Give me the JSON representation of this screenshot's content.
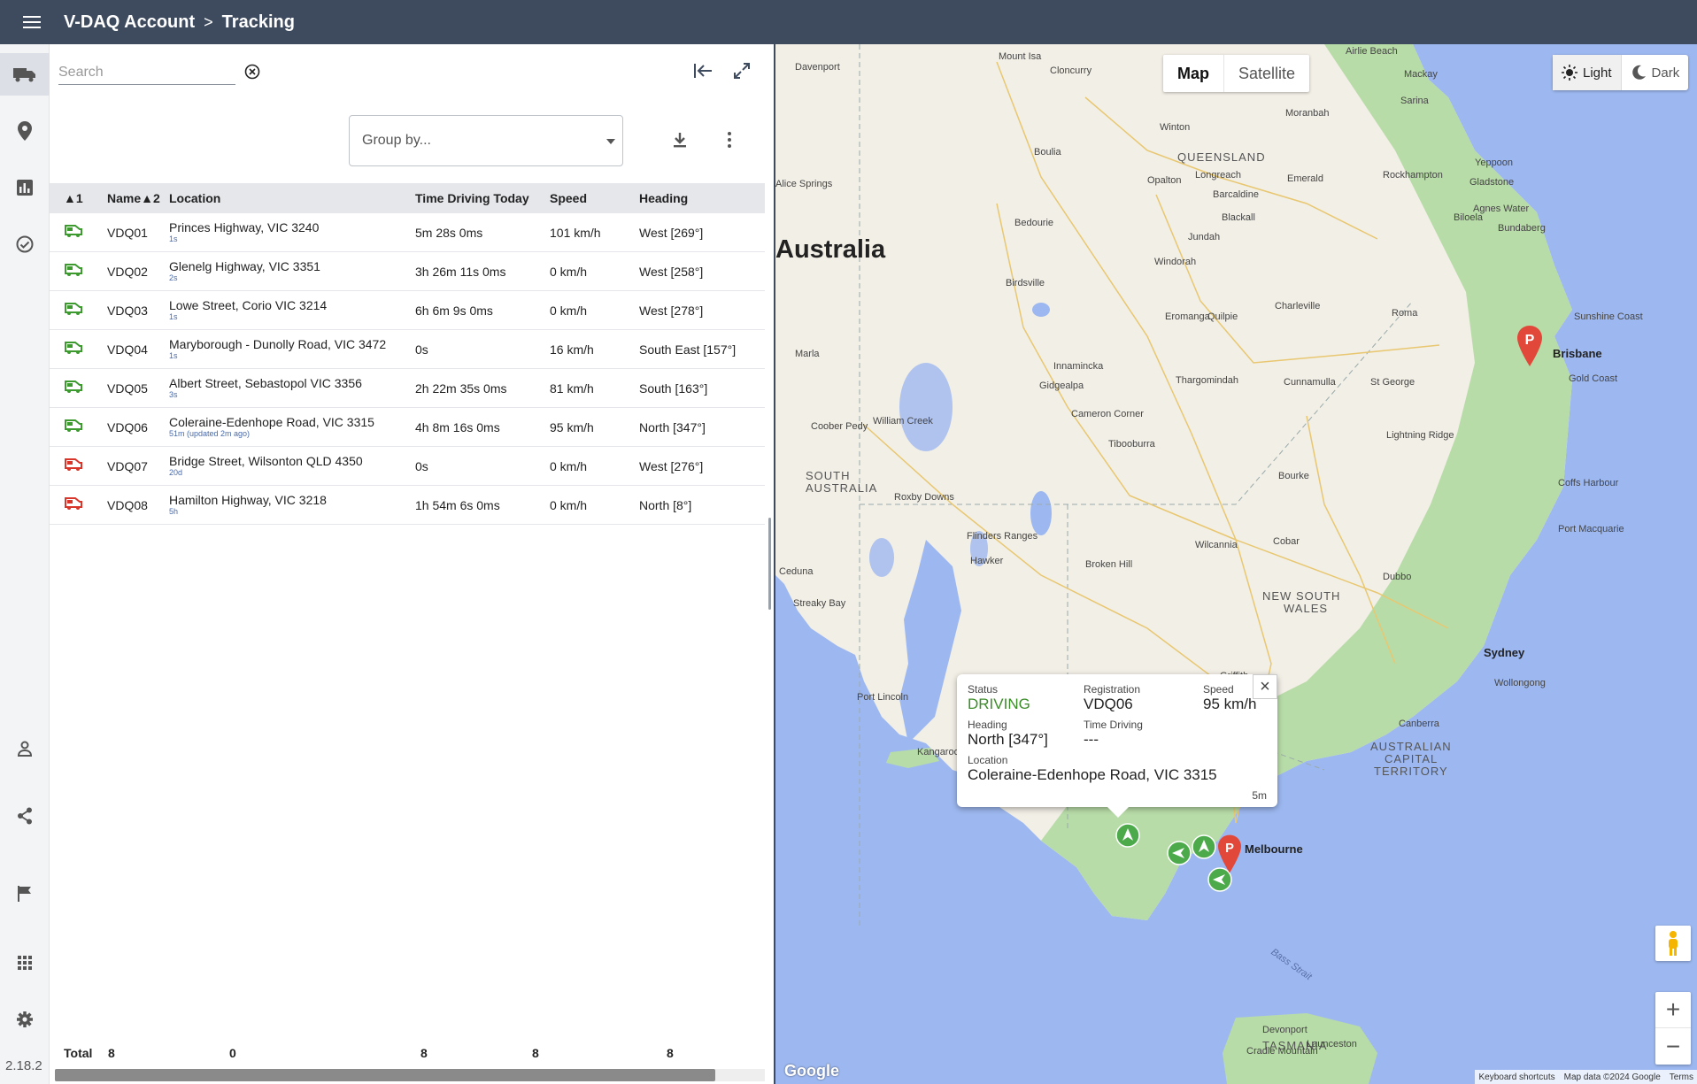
{
  "header": {
    "account": "V-DAQ Account",
    "separator": ">",
    "page": "Tracking"
  },
  "nav": {
    "icons": [
      "truck-icon",
      "location-pin-icon",
      "bar-chart-icon",
      "check-circle-icon",
      "person-icon",
      "share-icon",
      "flag-icon",
      "apps-grid-icon",
      "gear-icon"
    ],
    "version": "2.18.2"
  },
  "toolbar": {
    "search_placeholder": "Search",
    "group_by_placeholder": "Group by..."
  },
  "table": {
    "headers": {
      "col1": "▲1",
      "col2": "Name▲2",
      "location": "Location",
      "time_driving": "Time Driving Today",
      "speed": "Speed",
      "heading": "Heading"
    },
    "rows": [
      {
        "name": "VDQ01",
        "location": "Princes Highway, VIC 3240",
        "updated": "1s",
        "time": "5m 28s 0ms",
        "speed": "101 km/h",
        "heading": "West [269°]",
        "status_color": "#3c9a2f"
      },
      {
        "name": "VDQ02",
        "location": "Glenelg Highway, VIC 3351",
        "updated": "2s",
        "time": "3h 26m 11s 0ms",
        "speed": "0 km/h",
        "heading": "West [258°]",
        "status_color": "#3c9a2f"
      },
      {
        "name": "VDQ03",
        "location": "Lowe Street, Corio VIC 3214",
        "updated": "1s",
        "time": "6h 6m 9s 0ms",
        "speed": "0 km/h",
        "heading": "West [278°]",
        "status_color": "#3c9a2f"
      },
      {
        "name": "VDQ04",
        "location": "Maryborough - Dunolly Road, VIC 3472",
        "updated": "1s",
        "time": "0s",
        "speed": "16 km/h",
        "heading": "South East [157°]",
        "status_color": "#3c9a2f"
      },
      {
        "name": "VDQ05",
        "location": "Albert Street, Sebastopol VIC 3356",
        "updated": "3s",
        "time": "2h 22m 35s 0ms",
        "speed": "81 km/h",
        "heading": "South [163°]",
        "status_color": "#3c9a2f"
      },
      {
        "name": "VDQ06",
        "location": "Coleraine-Edenhope Road, VIC 3315",
        "updated": "51m (updated 2m ago)",
        "time": "4h 8m 16s 0ms",
        "speed": "95 km/h",
        "heading": "North [347°]",
        "status_color": "#3c9a2f"
      },
      {
        "name": "VDQ07",
        "location": "Bridge Street, Wilsonton QLD 4350",
        "updated": "20d",
        "time": "0s",
        "speed": "0 km/h",
        "heading": "West [276°]",
        "status_color": "#d9362b"
      },
      {
        "name": "VDQ08",
        "location": "Hamilton Highway, VIC 3218",
        "updated": "5h",
        "time": "1h 54m 6s 0ms",
        "speed": "0 km/h",
        "heading": "North [8°]",
        "status_color": "#d9362b"
      }
    ],
    "totals": {
      "label": "Total",
      "name": "8",
      "location": "0",
      "time": "8",
      "speed": "8",
      "heading": "8"
    }
  },
  "map": {
    "type_options": [
      "Map",
      "Satellite"
    ],
    "selected_type": "Map",
    "theme_options": [
      "Light",
      "Dark"
    ],
    "selected_theme": "Light",
    "labels": {
      "country": "Australia",
      "queensland": "QUEENSLAND",
      "south_australia_1": "SOUTH",
      "south_australia_2": "AUSTRALIA",
      "nsw_1": "NEW SOUTH",
      "nsw_2": "WALES",
      "act_1": "AUSTRALIAN",
      "act_2": "CAPITAL",
      "act_3": "TERRITORY",
      "tasmania": "TASMANIA",
      "brisbane": "Brisbane",
      "sydney": "Sydney",
      "melbourne": "Melbourne",
      "canberra": "Canberra",
      "gold_coast": "Gold Coast",
      "sunshine_coast": "Sunshine Coast",
      "bass_strait": "Bass Strait",
      "towns": [
        "Mount Isa",
        "Cloncurry",
        "Davenport",
        "Airlie Beach",
        "Mackay",
        "Sarina",
        "Moranbah",
        "Winton",
        "Emerald",
        "Rockhampton",
        "Yeppoon",
        "Gladstone",
        "Agnes Water",
        "Bundaberg",
        "Biloela",
        "Boulia",
        "Longreach",
        "Barcaldine",
        "Opalton",
        "Alice Springs",
        "Bedourie",
        "Blackall",
        "Jundah",
        "Windorah",
        "Charleville",
        "Birdsville",
        "Eromanga",
        "Quilpie",
        "Roma",
        "Marla",
        "Innamincka",
        "Gidgealpa",
        "Thargomindah",
        "Cunnamulla",
        "St George",
        "Coober Pedy",
        "William Creek",
        "Cameron Corner",
        "Tibooburra",
        "Lightning Ridge",
        "Bourke",
        "Coffs Harbour",
        "Roxby Downs",
        "Port Macquarie",
        "Flinders Ranges",
        "Hawker",
        "Wilcannia",
        "Cobar",
        "Dubbo",
        "Ceduna",
        "Broken Hill",
        "Streaky Bay",
        "Griffith",
        "Wollongong",
        "Port Lincoln",
        "Kangaroo Island",
        "Devonport",
        "Launceston",
        "Cradle Mountain"
      ]
    },
    "popup": {
      "status_label": "Status",
      "status_value": "DRIVING",
      "registration_label": "Registration",
      "registration_value": "VDQ06",
      "speed_label": "Speed",
      "speed_value": "95 km/h",
      "heading_label": "Heading",
      "heading_value": "North [347°]",
      "time_label": "Time Driving",
      "time_value": "---",
      "location_label": "Location",
      "location_value": "Coleraine-Edenhope Road, VIC 3315",
      "age": "5m",
      "close": "×"
    },
    "zoom_in": "+",
    "zoom_out": "−",
    "google": "Google",
    "attribution": [
      "Keyboard shortcuts",
      "Map data ©2024 Google",
      "Terms"
    ],
    "colors": {
      "water": "#9db8f0",
      "land": "#f2efe6",
      "green": "#a9d49a",
      "marker_green": "#4caa4a",
      "marker_red": "#e2483a"
    }
  }
}
